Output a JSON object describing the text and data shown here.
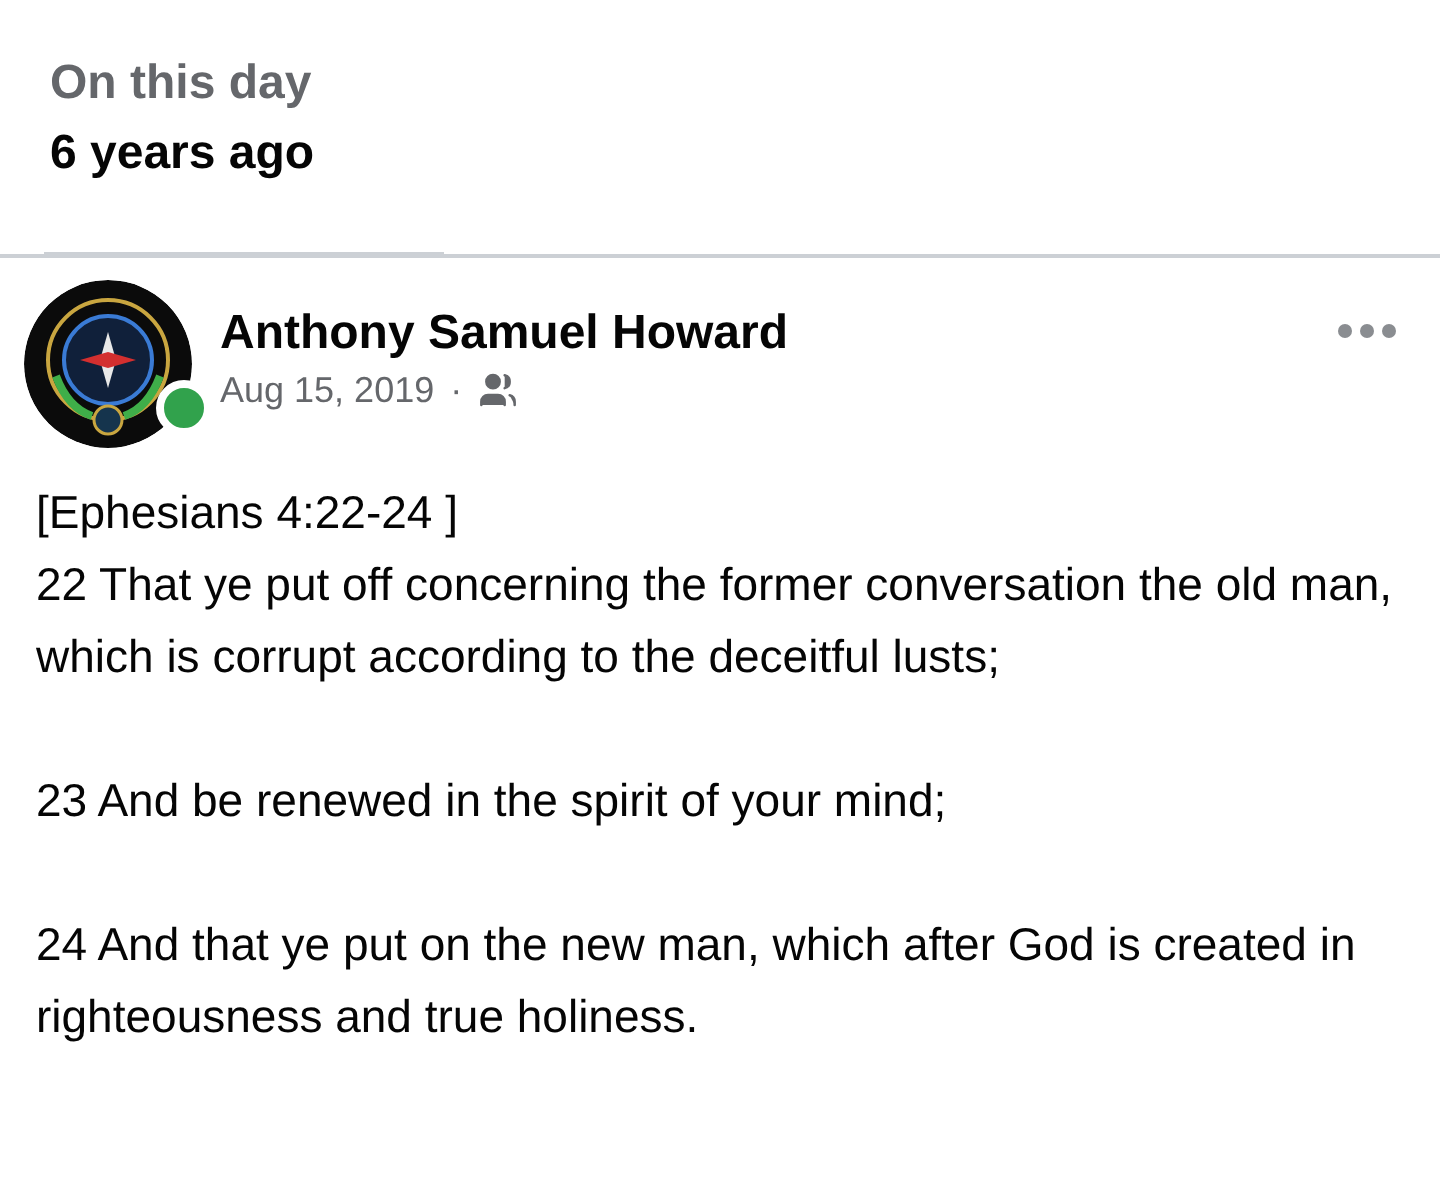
{
  "header": {
    "title": "On this day",
    "subtitle": "6 years ago"
  },
  "post": {
    "author": "Anthony Samuel Howard",
    "online": true,
    "date": "Aug 15, 2019",
    "separator": "·",
    "paragraphs": [
      "[Ephesians 4:22-24 ]\n22 That ye put off concerning the former conversation the old man, which is corrupt according to the deceitful lusts;",
      "23 And be renewed in the spirit of your mind;",
      "24 And that ye put on the new man, which after God is created in righteousness and true holiness."
    ]
  }
}
